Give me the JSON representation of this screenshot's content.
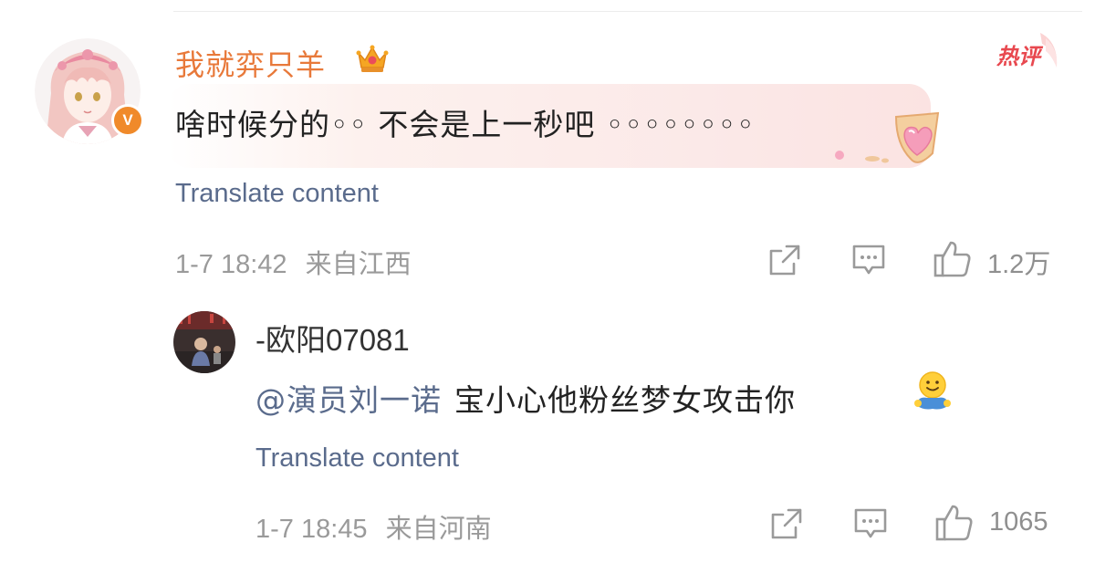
{
  "main_comment": {
    "username": "我就弈只羊",
    "text": "啥时候分的◦◦ 不会是上一秒吧 ◦◦◦◦◦◦◦◦",
    "translate_label": "Translate content",
    "timestamp": "1-7 18:42",
    "location": "来自江西",
    "like_count": "1.2万",
    "hot_badge": "热评",
    "verified_mark": "V",
    "username_color": "#e8793a"
  },
  "reply": {
    "username": "-欧阳07081",
    "mention": "@演员刘一诺",
    "text": "宝小心他粉丝梦女攻击你",
    "translate_label": "Translate content",
    "timestamp": "1-7 18:45",
    "location": "来自河南",
    "like_count": "1065",
    "link_color": "#5a6b8c"
  },
  "icons": {
    "share": "share-icon",
    "comment": "comment-icon",
    "like": "thumbs-up-icon",
    "crown": "crown-icon",
    "emoji": "hug-emoji-icon"
  }
}
